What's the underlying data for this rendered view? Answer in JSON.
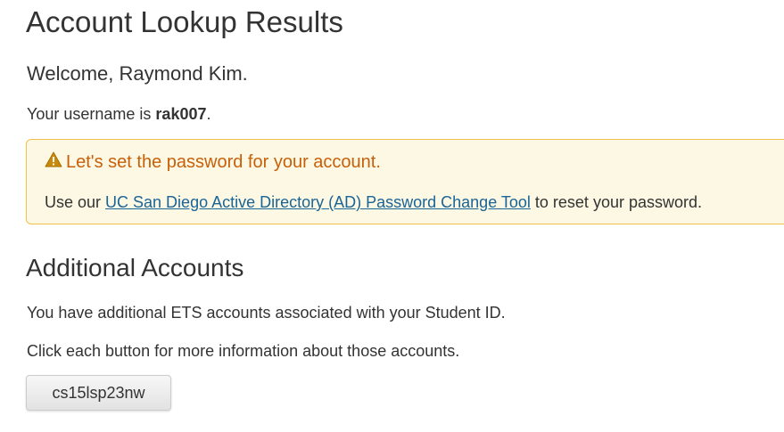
{
  "page": {
    "title": "Account Lookup Results"
  },
  "welcome": {
    "text": "Welcome, Raymond Kim."
  },
  "username": {
    "prefix": "Your username is ",
    "value": "rak007",
    "suffix": "."
  },
  "alert": {
    "icon": "warning-icon",
    "heading": "Let's set the password for your account.",
    "body_prefix": "Use our ",
    "link_text": "UC San Diego Active Directory (AD) Password Change Tool",
    "body_suffix": " to reset your password.",
    "colors": {
      "heading": "#c7600a",
      "background": "#fcf8e3",
      "border": "#f0c14b",
      "link": "#1a6496"
    }
  },
  "additional_accounts": {
    "title": "Additional Accounts",
    "description": "You have additional ETS accounts associated with your Student ID.",
    "instruction": "Click each button for more information about those accounts.",
    "accounts": [
      {
        "label": "cs15lsp23nw"
      }
    ]
  }
}
